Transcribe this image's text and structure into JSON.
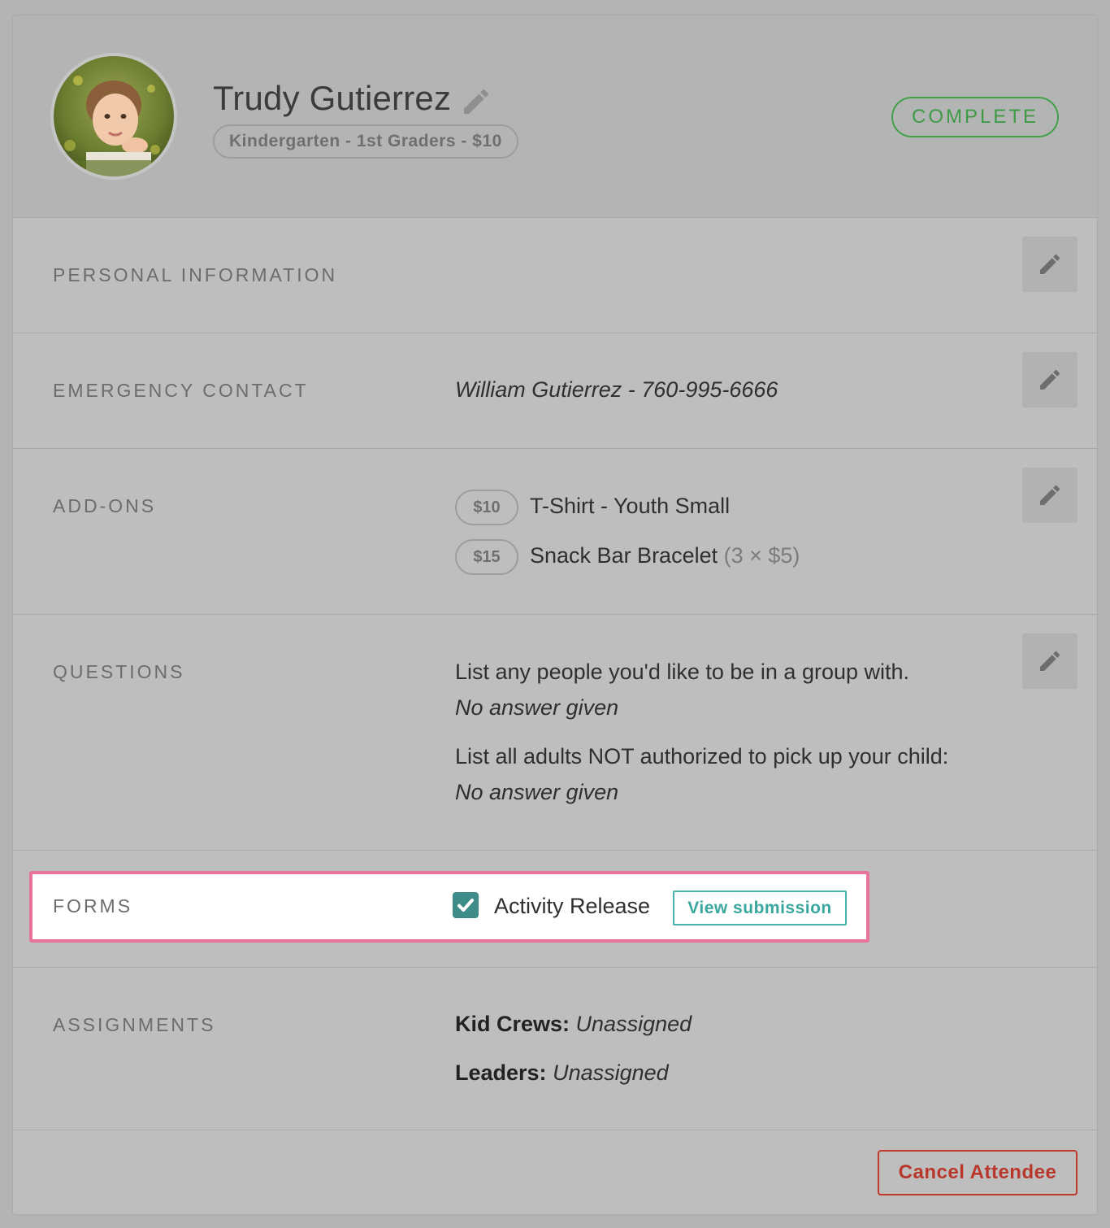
{
  "attendee": {
    "name": "Trudy Gutierrez",
    "ticket": "Kindergarten - 1st Graders - $10",
    "status": "COMPLETE"
  },
  "sections": {
    "personal": {
      "label": "PERSONAL INFORMATION"
    },
    "emergency": {
      "label": "EMERGENCY CONTACT",
      "value": "William Gutierrez - 760-995-6666"
    },
    "addons": {
      "label": "ADD-ONS",
      "items": [
        {
          "price": "$10",
          "name": "T-Shirt - Youth Small",
          "detail": ""
        },
        {
          "price": "$15",
          "name": "Snack Bar Bracelet",
          "detail": "(3 × $5)"
        }
      ]
    },
    "questions": {
      "label": "QUESTIONS",
      "items": [
        {
          "question": "List any people you'd like to be in a group with.",
          "answer": "No answer given"
        },
        {
          "question": "List all adults NOT authorized to pick up your child:",
          "answer": "No answer given"
        }
      ]
    },
    "forms": {
      "label": "FORMS",
      "form_name": "Activity Release",
      "checked": true,
      "view_label": "View submission"
    },
    "assignments": {
      "label": "ASSIGNMENTS",
      "items": [
        {
          "name": "Kid Crews:",
          "value": "Unassigned"
        },
        {
          "name": "Leaders:",
          "value": "Unassigned"
        }
      ]
    }
  },
  "footer": {
    "cancel_label": "Cancel Attendee"
  },
  "colors": {
    "status_green": "#41a048",
    "highlight_pink": "#e8739b",
    "teal": "#3d8c88",
    "cancel_red": "#c0392b"
  },
  "icons": {
    "edit": "pencil-icon",
    "check": "checkmark-icon"
  }
}
